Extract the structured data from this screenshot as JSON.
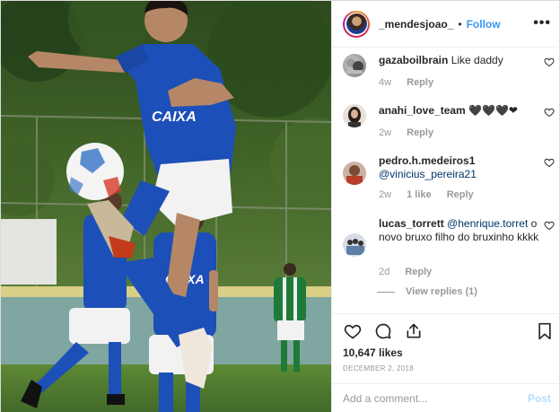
{
  "header": {
    "username": "_mendesjoao_",
    "separator": "•",
    "follow_label": "Follow",
    "more_label": "•••"
  },
  "photo": {
    "sponsor_text": "CAIXA",
    "colors": {
      "kit_blue": "#1d4fb8",
      "kit_white": "#f2f2f2",
      "grass": "#4f7d2b",
      "opponent_green": "#1f7a3a"
    }
  },
  "comments": [
    {
      "username": "gazaboilbrain",
      "text": "Like daddy",
      "time": "4w",
      "likes": "",
      "reply_label": "Reply"
    },
    {
      "username": "anahi_love_team",
      "text": "🖤🖤🖤❤",
      "time": "2w",
      "likes": "",
      "reply_label": "Reply"
    },
    {
      "username": "pedro.h.medeiros1",
      "mention": "@vinicius_pereira21",
      "text": "",
      "time": "2w",
      "likes": "1 like",
      "reply_label": "Reply"
    },
    {
      "username": "lucas_torrett",
      "mention": "@henrique.torret",
      "text": " o novo bruxo filho do bruxinho kkkk",
      "time": "2d",
      "likes": "",
      "reply_label": "Reply"
    }
  ],
  "view_replies_label": "View replies (1)",
  "actions": {
    "icons": [
      "heart-icon",
      "comment-icon",
      "share-icon",
      "bookmark-icon"
    ],
    "likes_text": "10,647 likes",
    "date": "DECEMBER 2, 2018"
  },
  "add_comment": {
    "placeholder": "Add a comment...",
    "post_label": "Post"
  }
}
